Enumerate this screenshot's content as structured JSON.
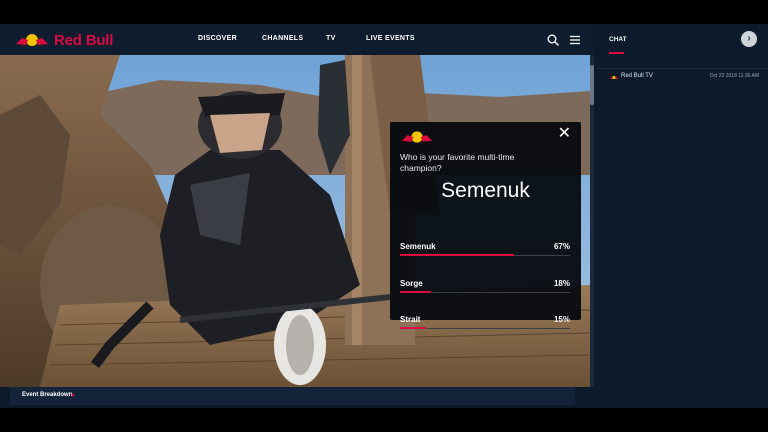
{
  "header": {
    "brand": "Red Bull",
    "nav": [
      "DISCOVER",
      "CHANNELS",
      "TV",
      "LIVE EVENTS"
    ]
  },
  "poll": {
    "question": "Who is your favorite multi-time champion?",
    "leader": "Semenuk",
    "options": [
      {
        "name": "Semenuk",
        "percent": "67%",
        "value": 0.67
      },
      {
        "name": "Sorge",
        "percent": "18%",
        "value": 0.18
      },
      {
        "name": "Strait",
        "percent": "15%",
        "value": 0.15
      }
    ]
  },
  "video": {
    "bottom_label": "Event Breakdown"
  },
  "chat": {
    "title": "CHAT",
    "messages": [
      {
        "author": "Red Bull TV",
        "time": "Oct 23 2018 11:36 AM"
      }
    ]
  },
  "colors": {
    "accent": "#db0a40",
    "panel": "#0c1a2c"
  }
}
